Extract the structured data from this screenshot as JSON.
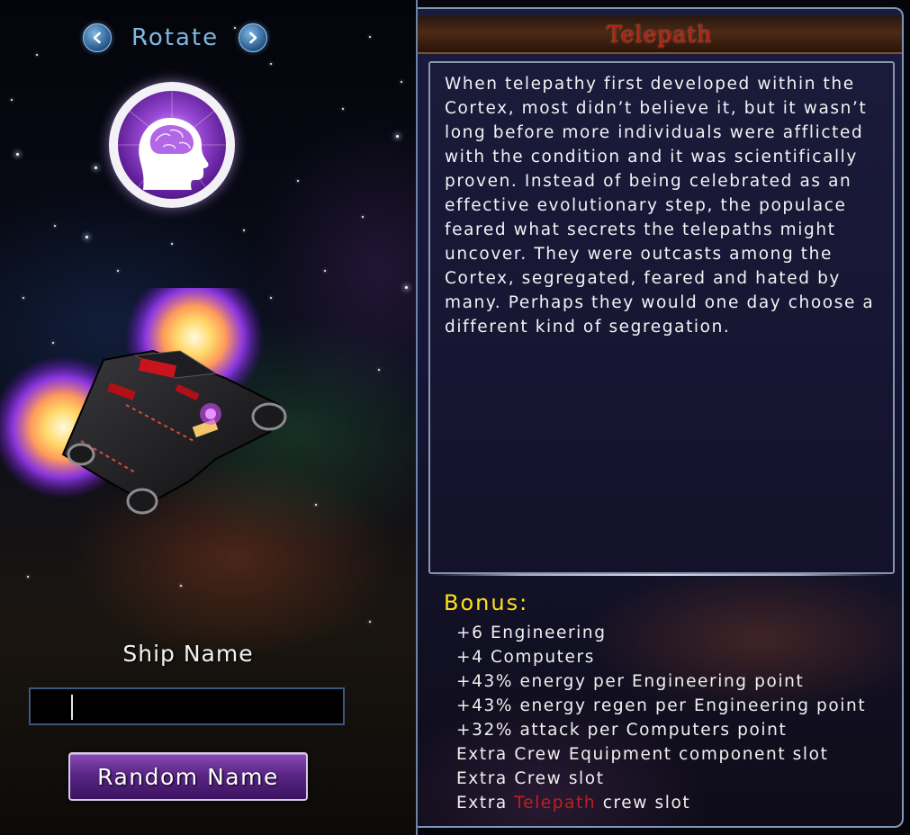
{
  "rotate": {
    "label": "Rotate"
  },
  "class_icon": {
    "name": "telepath-brain-icon"
  },
  "ship_name": {
    "label": "Ship Name",
    "value": ""
  },
  "random_name": {
    "label": "Random Name"
  },
  "panel": {
    "title": "Telepath",
    "description": "When telepathy first developed within the Cortex, most didn’t believe it, but it wasn’t long before more individuals were afflicted with the condition and it was scientifically proven. Instead of being celebrated as an effective evolutionary step, the populace feared what secrets the telepaths might uncover. They were outcasts among the Cortex, segregated, feared and hated by many. Perhaps they would one day choose a different kind of segregation.",
    "bonus_title": "Bonus:",
    "bonuses": [
      "+6 Engineering",
      "+4 Computers",
      "+43% energy per Engineering point",
      "+43% energy regen per Engineering point",
      "+32% attack per Computers point",
      "Extra Crew Equipment component slot",
      "Extra Crew slot"
    ],
    "last_bonus": {
      "prefix": "Extra ",
      "highlight": "Telepath",
      "suffix": " crew slot"
    }
  },
  "colors": {
    "title_red": "#b11d12",
    "bonus_yellow": "#ffe21a",
    "button_purple": "#5a2686",
    "border_blue": "#7f96b8"
  }
}
